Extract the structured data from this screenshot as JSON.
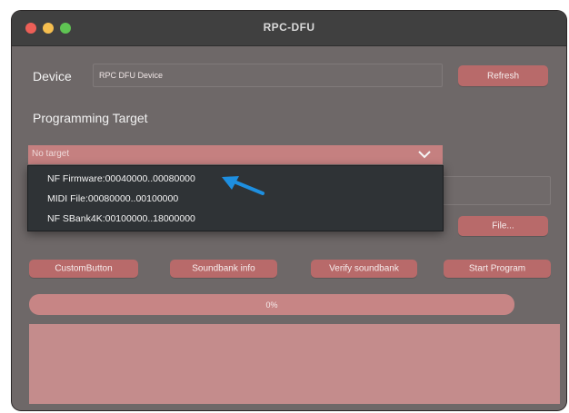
{
  "window": {
    "title": "RPC-DFU"
  },
  "device": {
    "label": "Device",
    "value": "RPC DFU Device",
    "refresh_label": "Refresh"
  },
  "programming": {
    "label": "Programming Target"
  },
  "target_select": {
    "selected": "No target",
    "options": [
      "NF Firmware:00040000..00080000",
      "MIDI File:00080000..00100000",
      "NF SBank4K:00100000..18000000"
    ]
  },
  "file": {
    "label": "File..."
  },
  "actions": {
    "custom_label": "CustomButton",
    "soundbank_info_label": "Soundbank info",
    "verify_label": "Verify soundbank",
    "start_label": "Start Program"
  },
  "progress": {
    "text": "0%",
    "value": 0
  },
  "colors": {
    "button": "#b86a6a",
    "dropdown_bg": "#2f3336",
    "arrow": "#1e8fe0",
    "log_bg": "#c48c8c"
  }
}
